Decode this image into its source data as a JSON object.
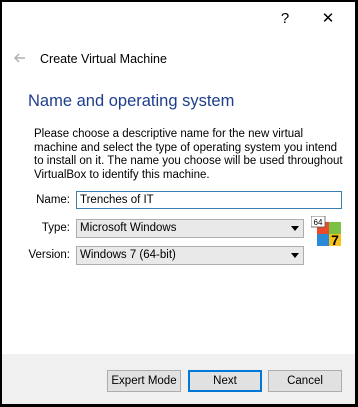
{
  "titlebar": {
    "help_label": "?",
    "close_label": "✕"
  },
  "header": {
    "back_icon": "back-arrow-icon",
    "title": "Create Virtual Machine"
  },
  "page": {
    "section_title": "Name and operating system",
    "description": "Please choose a descriptive name for the new virtual machine and select the type of operating system you intend to install on it. The name you choose will be used throughout VirtualBox to identify this machine."
  },
  "form": {
    "name_label": "Name:",
    "name_value": "Trenches of IT",
    "type_label": "Type:",
    "type_value": "Microsoft Windows",
    "version_label": "Version:",
    "version_value": "Windows 7 (64-bit)",
    "os_icon": "windows-7-64bit-icon",
    "os_icon_badge": "64"
  },
  "footer": {
    "expert_mode_label": "Expert Mode",
    "next_label": "Next",
    "cancel_label": "Cancel"
  },
  "colors": {
    "section_title": "#1e3d8c",
    "focus_border": "#3c7fb1",
    "default_button_border": "#0078d7"
  }
}
